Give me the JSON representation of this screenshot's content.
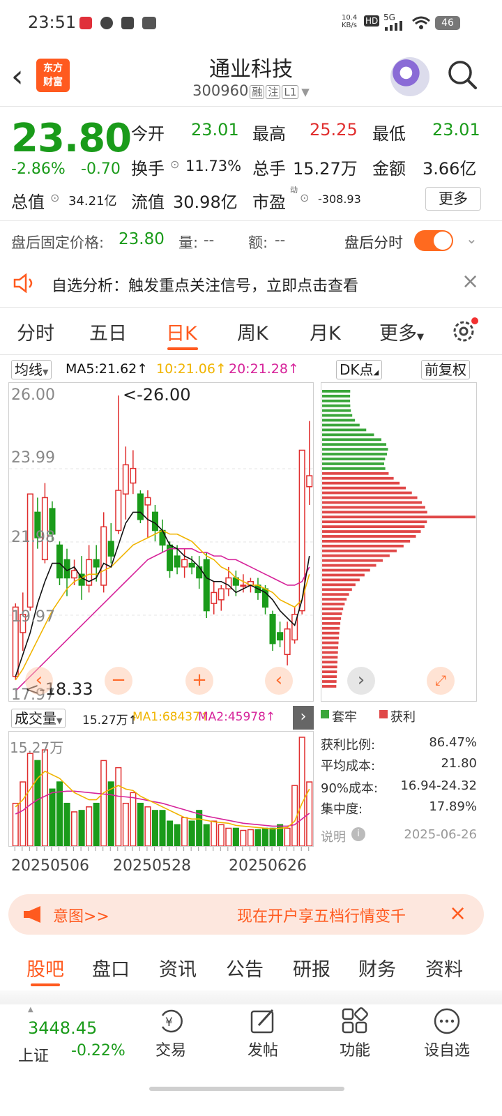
{
  "status": {
    "time": "23:51",
    "net_speed": "10.4\nKB/s",
    "hd": "HD",
    "signal": "5G",
    "battery": "46"
  },
  "header": {
    "logo": "东方\n财富",
    "title": "通业科技",
    "code": "300960",
    "tags": [
      "融",
      "注",
      "L1"
    ]
  },
  "quote": {
    "price": "23.80",
    "change_pct": "-2.86%",
    "change": "-0.70",
    "open_label": "今开",
    "open": "23.01",
    "high_label": "最高",
    "high": "25.25",
    "low_label": "最低",
    "low": "23.01",
    "turnover_label": "换手",
    "turnover": "11.73%",
    "volume_label": "总手",
    "volume": "15.27万",
    "amount_label": "金额",
    "amount": "3.66亿",
    "mktcap_label": "总值",
    "mktcap": "34.21亿",
    "float_label": "流值",
    "float_cap": "30.98亿",
    "pe_label": "市盈",
    "pe_sup": "动",
    "pe": "-308.93",
    "more_label": "更多"
  },
  "afterhours": {
    "label": "盘后固定价格:",
    "price": "23.80",
    "vol_label": "量:",
    "vol": "--",
    "amt_label": "额:",
    "amt": "--",
    "toggle_label": "盘后分时"
  },
  "banner": {
    "text": "自选分析：触发重点关注信号，立即点击查看"
  },
  "ktabs": [
    "分时",
    "五日",
    "日K",
    "周K",
    "月K",
    "更多"
  ],
  "ma": {
    "selector": "均线",
    "ma5": "MA5:21.62↑",
    "ma10": "10:21.06↑",
    "ma20": "20:21.28↑",
    "dk": "DK点",
    "adj": "前复权"
  },
  "kchart": {
    "y_labels": [
      "26.00",
      "23.99",
      "21.98",
      "19.97",
      "17.97"
    ],
    "max_annot": "<-26.00",
    "min_annot": "<-18.33"
  },
  "chart_data": {
    "type": "candlestick",
    "title": "",
    "ylim": [
      17.97,
      26.0
    ],
    "x_labels": [
      "20250506",
      "20250528",
      "20250626"
    ],
    "candles": [
      {
        "o": 18.3,
        "c": 20.2,
        "h": 20.3,
        "l": 18.2
      },
      {
        "o": 19.5,
        "c": 20.0,
        "h": 20.6,
        "l": 19.0
      },
      {
        "o": 20.2,
        "c": 23.3,
        "h": 23.3,
        "l": 20.1
      },
      {
        "o": 22.8,
        "c": 22.1,
        "h": 23.2,
        "l": 21.8
      },
      {
        "o": 21.5,
        "c": 23.2,
        "h": 23.6,
        "l": 21.4
      },
      {
        "o": 22.9,
        "c": 22.2,
        "h": 23.1,
        "l": 22.0
      },
      {
        "o": 21.9,
        "c": 21.0,
        "h": 22.0,
        "l": 20.8
      },
      {
        "o": 21.5,
        "c": 21.0,
        "h": 21.8,
        "l": 20.5
      },
      {
        "o": 21.0,
        "c": 21.2,
        "h": 21.5,
        "l": 20.8
      },
      {
        "o": 21.1,
        "c": 20.8,
        "h": 21.6,
        "l": 20.4
      },
      {
        "o": 20.8,
        "c": 21.5,
        "h": 21.9,
        "l": 20.6
      },
      {
        "o": 21.5,
        "c": 21.3,
        "h": 21.9,
        "l": 20.9
      },
      {
        "o": 20.8,
        "c": 22.4,
        "h": 22.8,
        "l": 20.6
      },
      {
        "o": 22.0,
        "c": 21.6,
        "h": 22.5,
        "l": 21.4
      },
      {
        "o": 22.3,
        "c": 23.4,
        "h": 26.0,
        "l": 22.2
      },
      {
        "o": 23.3,
        "c": 24.1,
        "h": 24.6,
        "l": 22.6
      },
      {
        "o": 23.6,
        "c": 24.0,
        "h": 24.5,
        "l": 23.3
      },
      {
        "o": 23.3,
        "c": 22.6,
        "h": 23.4,
        "l": 22.5
      },
      {
        "o": 23.0,
        "c": 23.2,
        "h": 23.4,
        "l": 22.1
      },
      {
        "o": 22.8,
        "c": 22.3,
        "h": 23.0,
        "l": 22.0
      },
      {
        "o": 22.3,
        "c": 21.9,
        "h": 22.6,
        "l": 21.7
      },
      {
        "o": 21.9,
        "c": 21.2,
        "h": 22.0,
        "l": 21.0
      },
      {
        "o": 21.6,
        "c": 21.3,
        "h": 21.9,
        "l": 21.1
      },
      {
        "o": 21.3,
        "c": 21.5,
        "h": 21.8,
        "l": 21.0
      },
      {
        "o": 21.4,
        "c": 21.3,
        "h": 21.6,
        "l": 21.1
      },
      {
        "o": 21.3,
        "c": 21.0,
        "h": 21.6,
        "l": 20.7
      },
      {
        "o": 21.5,
        "c": 20.1,
        "h": 21.7,
        "l": 19.9
      },
      {
        "o": 20.3,
        "c": 20.6,
        "h": 20.9,
        "l": 20.0
      },
      {
        "o": 20.4,
        "c": 20.7,
        "h": 20.8,
        "l": 20.1
      },
      {
        "o": 20.7,
        "c": 21.0,
        "h": 21.3,
        "l": 20.5
      },
      {
        "o": 21.0,
        "c": 20.8,
        "h": 21.2,
        "l": 20.5
      },
      {
        "o": 20.8,
        "c": 20.8,
        "h": 21.1,
        "l": 20.6
      },
      {
        "o": 20.8,
        "c": 20.9,
        "h": 21.0,
        "l": 20.6
      },
      {
        "o": 20.8,
        "c": 20.6,
        "h": 21.0,
        "l": 20.4
      },
      {
        "o": 20.7,
        "c": 20.2,
        "h": 20.8,
        "l": 20.0
      },
      {
        "o": 20.0,
        "c": 19.2,
        "h": 20.1,
        "l": 19.0
      },
      {
        "o": 19.5,
        "c": 19.3,
        "h": 19.8,
        "l": 19.1
      },
      {
        "o": 18.9,
        "c": 19.6,
        "h": 19.8,
        "l": 18.6
      },
      {
        "o": 19.3,
        "c": 20.0,
        "h": 20.2,
        "l": 19.2
      },
      {
        "o": 20.1,
        "c": 24.5,
        "h": 24.5,
        "l": 20.0
      },
      {
        "o": 23.5,
        "c": 23.8,
        "h": 25.3,
        "l": 23.0
      }
    ],
    "ma5": [
      18.3,
      18.9,
      19.5,
      20.3,
      20.9,
      21.4,
      21.4,
      21.2,
      21.3,
      21.0,
      20.9,
      21.0,
      21.4,
      21.3,
      21.9,
      22.5,
      22.8,
      22.8,
      22.6,
      22.5,
      22.3,
      21.9,
      21.8,
      21.6,
      21.5,
      21.3,
      21.0,
      20.9,
      20.9,
      20.8,
      20.6,
      20.7,
      20.8,
      20.7,
      20.6,
      20.4,
      20.1,
      19.9,
      19.7,
      20.4,
      21.6
    ],
    "ma10": [
      18.2,
      18.5,
      18.9,
      19.3,
      19.7,
      20.1,
      20.4,
      20.7,
      20.9,
      21.0,
      21.1,
      21.1,
      21.2,
      21.3,
      21.5,
      21.7,
      21.9,
      22.0,
      22.1,
      22.2,
      22.3,
      22.2,
      22.2,
      22.1,
      22.0,
      21.8,
      21.6,
      21.5,
      21.3,
      21.2,
      21.0,
      20.9,
      20.8,
      20.8,
      20.7,
      20.6,
      20.4,
      20.3,
      20.2,
      20.4,
      21.1
    ],
    "ma20": [
      17.9,
      18.1,
      18.3,
      18.5,
      18.7,
      18.9,
      19.1,
      19.3,
      19.5,
      19.7,
      19.9,
      20.1,
      20.3,
      20.5,
      20.7,
      20.9,
      21.1,
      21.3,
      21.5,
      21.6,
      21.7,
      21.8,
      21.8,
      21.8,
      21.8,
      21.7,
      21.7,
      21.6,
      21.6,
      21.5,
      21.5,
      21.4,
      21.3,
      21.2,
      21.1,
      21.0,
      20.9,
      20.8,
      20.8,
      20.9,
      21.3
    ],
    "volume_ylim": [
      0,
      15.27
    ],
    "volume": [
      6.0,
      9.0,
      13.0,
      12.0,
      13.5,
      8.0,
      9.0,
      6.0,
      4.8,
      5.0,
      5.5,
      6.0,
      12.0,
      9.0,
      11.0,
      6.0,
      7.5,
      6.0,
      5.5,
      5.0,
      5.0,
      3.5,
      3.0,
      4.0,
      3.5,
      5.0,
      3.0,
      3.5,
      3.0,
      2.5,
      2.5,
      2.2,
      2.3,
      2.3,
      2.5,
      2.5,
      3.0,
      2.5,
      8.5,
      15.27,
      9.0
    ],
    "vol_ma1": [
      5.5,
      6.5,
      8.0,
      9.5,
      10.5,
      10.0,
      9.5,
      8.5,
      7.5,
      7.0,
      6.5,
      6.5,
      7.5,
      8.0,
      8.5,
      8.0,
      7.8,
      7.0,
      6.5,
      6.0,
      5.5,
      5.0,
      4.5,
      4.0,
      3.8,
      3.8,
      3.6,
      3.4,
      3.3,
      3.2,
      2.9,
      2.8,
      2.7,
      2.6,
      2.5,
      2.4,
      2.5,
      2.6,
      3.5,
      6.0,
      8.0
    ],
    "vol_ma2": [
      4.5,
      5.0,
      5.8,
      6.5,
      7.0,
      7.5,
      7.6,
      7.7,
      7.7,
      7.6,
      7.5,
      7.4,
      7.3,
      7.2,
      7.0,
      6.9,
      6.8,
      6.6,
      6.4,
      6.2,
      6.0,
      5.7,
      5.4,
      5.1,
      4.8,
      4.5,
      4.2,
      4.0,
      3.8,
      3.6,
      3.4,
      3.2,
      3.1,
      3.0,
      2.9,
      2.8,
      2.8,
      2.8,
      3.0,
      3.8,
      4.6
    ],
    "chip_profit_pct": "86.47%"
  },
  "chip": {
    "legend_trap": "套牢",
    "legend_profit": "获利",
    "rows": [
      {
        "label": "获利比例:",
        "value": "86.47%"
      },
      {
        "label": "平均成本:",
        "value": "21.80"
      },
      {
        "label": "90%成本:",
        "value": "16.94-24.32"
      },
      {
        "label": "集中度:",
        "value": "17.89%"
      }
    ],
    "note_label": "说明",
    "date": "2025-06-26"
  },
  "volume": {
    "selector": "成交量",
    "value": "15.27万↑",
    "ma1": "MA1:68437↑",
    "ma2": "MA2:45978↑",
    "ylabel": "15.27万"
  },
  "ad": {
    "left": "意图>>",
    "text": "现在开户享五档行情变千"
  },
  "bottom_tabs": [
    "股吧",
    "盘口",
    "资讯",
    "公告",
    "研报",
    "财务",
    "资料"
  ],
  "bottom_nav": {
    "index_value": "3448.45",
    "index_name": "上证",
    "index_change": "-0.22%",
    "trade": "交易",
    "post": "发帖",
    "func": "功能",
    "watch": "设自选"
  },
  "colors": {
    "accent": "#ff5a1f",
    "up": "#e02e2e",
    "down": "#1a9b1a",
    "ma5": "#111111",
    "ma10": "#f0b400",
    "ma20": "#d6239a"
  }
}
